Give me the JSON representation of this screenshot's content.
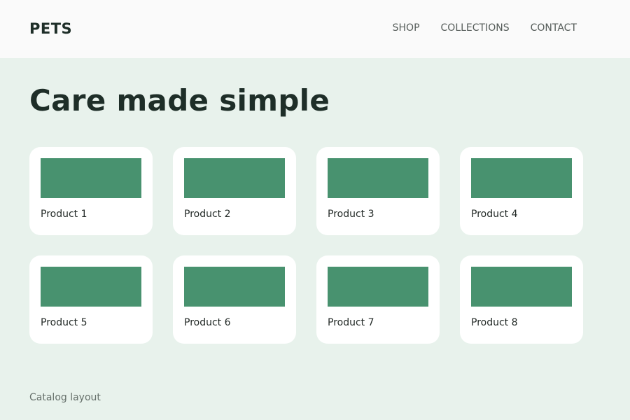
{
  "header": {
    "brand": "PETS",
    "nav": [
      {
        "label": "SHOP"
      },
      {
        "label": "COLLECTIONS"
      },
      {
        "label": "CONTACT"
      }
    ]
  },
  "hero": {
    "title": "Care made simple"
  },
  "products": [
    {
      "name": "Product 1"
    },
    {
      "name": "Product 2"
    },
    {
      "name": "Product 3"
    },
    {
      "name": "Product 4"
    },
    {
      "name": "Product 5"
    },
    {
      "name": "Product 6"
    },
    {
      "name": "Product 7"
    },
    {
      "name": "Product 8"
    }
  ],
  "footer": {
    "caption": "Catalog layout"
  },
  "colors": {
    "page_background": "#e8f2ec",
    "header_background": "#fafafa",
    "product_image": "#48926f",
    "text_dark": "#1e2e28"
  }
}
